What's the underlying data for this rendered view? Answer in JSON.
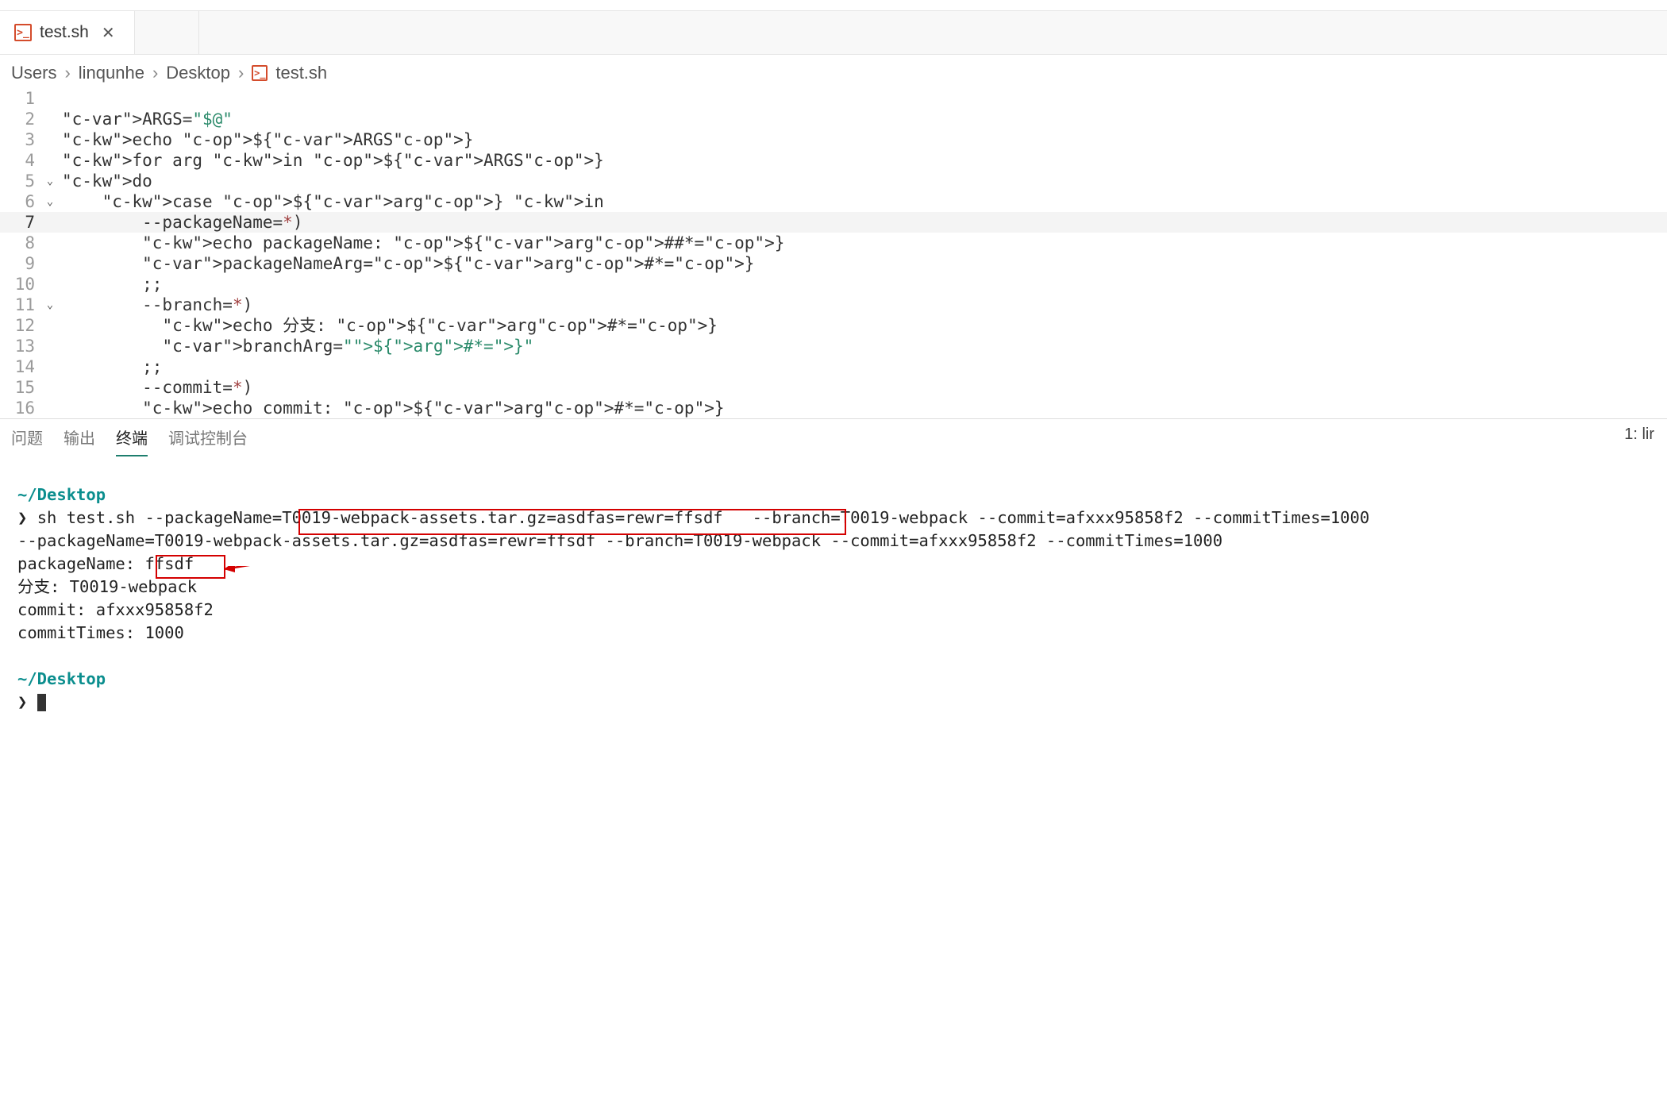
{
  "tab": {
    "filename": "test.sh"
  },
  "breadcrumbs": {
    "p1": "Users",
    "p2": "linqunhe",
    "p3": "Desktop",
    "p4": "test.sh",
    "sep": "›"
  },
  "code": {
    "lines": [
      {
        "n": "1",
        "fold": "",
        "raw": ""
      },
      {
        "n": "2",
        "fold": "",
        "raw": "ARGS=\"$@\""
      },
      {
        "n": "3",
        "fold": "",
        "raw": "echo ${ARGS}"
      },
      {
        "n": "4",
        "fold": "",
        "raw": "for arg in ${ARGS}"
      },
      {
        "n": "5",
        "fold": "⌄",
        "raw": "do"
      },
      {
        "n": "6",
        "fold": "⌄",
        "raw": "    case ${arg} in"
      },
      {
        "n": "7",
        "fold": "",
        "raw": "        --packageName=*)"
      },
      {
        "n": "8",
        "fold": "",
        "raw": "        echo packageName: ${arg##*=}"
      },
      {
        "n": "9",
        "fold": "",
        "raw": "        packageNameArg=${arg#*=}"
      },
      {
        "n": "10",
        "fold": "",
        "raw": "        ;;"
      },
      {
        "n": "11",
        "fold": "⌄",
        "raw": "        --branch=*)"
      },
      {
        "n": "12",
        "fold": "",
        "raw": "          echo 分支: ${arg#*=}"
      },
      {
        "n": "13",
        "fold": "",
        "raw": "          branchArg=\"${arg#*=}\""
      },
      {
        "n": "14",
        "fold": "",
        "raw": "        ;;"
      },
      {
        "n": "15",
        "fold": "",
        "raw": "        --commit=*)"
      },
      {
        "n": "16",
        "fold": "",
        "raw": "        echo commit: ${arg#*=}"
      }
    ]
  },
  "panel": {
    "tabs": {
      "problems": "问题",
      "output": "输出",
      "terminal": "终端",
      "debug": "调试控制台"
    },
    "right": "1: lir"
  },
  "terminal": {
    "cwd": "~/Desktop",
    "prompt": "❯",
    "cmd": "sh test.sh --packageName=T0019-webpack-assets.tar.gz=asdfas=rewr=ffsdf   --branch=T0019-webpack --commit=afxxx95858f2 --commitTimes=1000",
    "out1": "--packageName=T0019-webpack-assets.tar.gz=asdfas=rewr=ffsdf --branch=T0019-webpack --commit=afxxx95858f2 --commitTimes=1000",
    "out2": "packageName: ffsdf",
    "out3": "分支: T0019-webpack",
    "out4": "commit: afxxx95858f2",
    "out5": "commitTimes: 1000"
  }
}
